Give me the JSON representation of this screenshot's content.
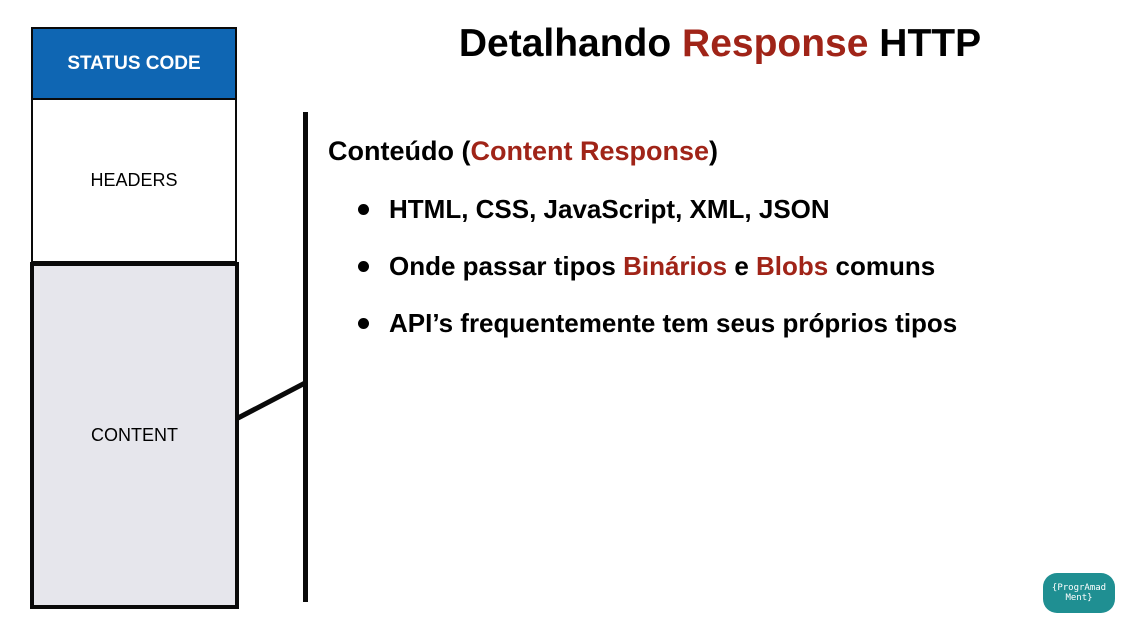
{
  "title": {
    "part1": "Detalhando ",
    "highlight": "Response",
    "part2": " HTTP"
  },
  "diagram": {
    "status_code": "STATUS CODE",
    "headers": "HEADERS",
    "content": "CONTENT"
  },
  "subheading": {
    "part1": "Conteúdo (",
    "highlight": "Content Response",
    "part2": ")"
  },
  "bullets": {
    "b1": "HTML, CSS, JavaScript, XML, JSON",
    "b2": {
      "part1": "Onde passar tipos ",
      "h1": "Binários",
      "mid": " e ",
      "h2": "Blobs",
      "part2": " comuns"
    },
    "b3": "API’s frequentemente tem seus próprios tipos"
  },
  "logo": {
    "line1": "{ProgrAmad",
    "line2": "Ment}"
  },
  "colors": {
    "accent_red": "#a02418",
    "status_blue": "#0f66b3",
    "content_gray": "#e6e6ec",
    "logo_teal": "#1f8f92"
  }
}
